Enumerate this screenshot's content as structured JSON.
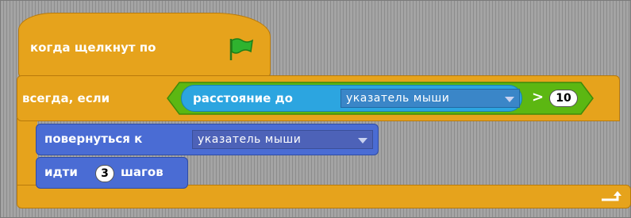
{
  "hat_block": {
    "label": "когда щелкнут по",
    "icon": "green-flag-icon"
  },
  "forever_if_block": {
    "label": "всегда, если",
    "condition": {
      "sensor_label": "расстояние до",
      "sensor_target": "указатель мыши",
      "operator": ">",
      "value": "10"
    }
  },
  "inner_blocks": {
    "turn": {
      "label": "повернуться к",
      "target": "указатель мыши"
    },
    "move": {
      "label_before": "идти",
      "steps": "3",
      "label_after": "шагов"
    }
  },
  "colors": {
    "control": "#e6a31c",
    "sensing": "#2ca5e0",
    "motion": "#4a6cd4",
    "operator": "#5cb712",
    "flag": "#2fb32f"
  }
}
